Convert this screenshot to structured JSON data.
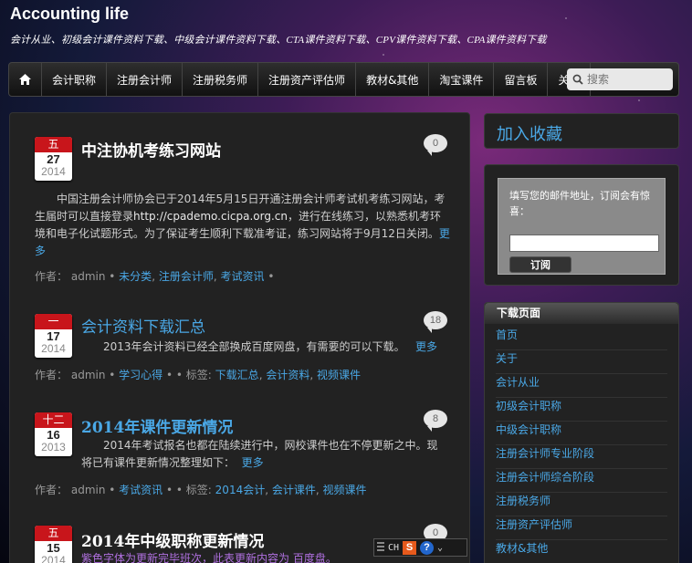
{
  "header": {
    "title": "Accounting life",
    "description": "会计从业、初级会计课件资料下载、中级会计课件资料下载、CTA课件资料下载、CPV课件资料下载、CPA课件资料下载"
  },
  "nav": {
    "items": [
      "会计职称",
      "注册会计师",
      "注册税务师",
      "注册资产评估师",
      "教材&其他",
      "淘宝课件",
      "留言板",
      "关于"
    ],
    "search_placeholder": "搜索"
  },
  "posts": [
    {
      "month": "五",
      "day": "27",
      "year": "2014",
      "title": "中注协机考练习网站",
      "comments": "0",
      "excerpt_text": "中国注册会计师协会已于2014年5月15日开通注册会计师考试机考练习网站，考生届时可以直接登录",
      "excerpt_link": "http://cpademo.cicpa.org.cn",
      "excerpt_after": "，进行在线练习，以熟悉机考环境和电子化试题形式。为了保证考生顺利下载准考证，练习网站将于9月12日关闭。",
      "more": "更多",
      "meta_author_label": "作者：",
      "meta_author": "admin",
      "meta_cats": [
        "未分类",
        "注册会计师",
        "考试资讯"
      ]
    },
    {
      "month": "一",
      "day": "17",
      "year": "2014",
      "title": "会计资料下载汇总",
      "comments": "18",
      "excerpt_text": "2013年会计资料已经全部换成百度网盘，有需要的可以下载。",
      "more": "更多",
      "meta_author_label": "作者：",
      "meta_author": "admin",
      "meta_cats": [
        "学习心得"
      ],
      "meta_tags_label": "标签:",
      "meta_tags": [
        "下载汇总",
        "会计资料",
        "视频课件"
      ]
    },
    {
      "month": "十二",
      "day": "16",
      "year": "2013",
      "title": "2014年课件更新情况",
      "comments": "8",
      "excerpt_text": "2014年考试报名也都在陆续进行中，网校课件也在不停更新之中。现将已有课件更新情况整理如下：",
      "more": "更多",
      "meta_author_label": "作者：",
      "meta_author": "admin",
      "meta_cats": [
        "考试资讯"
      ],
      "meta_tags_label": "标签:",
      "meta_tags": [
        "2014会计",
        "会计课件",
        "视频课件"
      ]
    },
    {
      "month": "五",
      "day": "15",
      "year": "2014",
      "title": "2014年中级职称更新情况",
      "comments": "0",
      "excerpt_text": "紫色字体为更新完毕班次，此表更新内容为 百度盘。"
    }
  ],
  "sidebar": {
    "favorite": "加入收藏",
    "subscribe_text": "填写您的邮件地址，订阅会有惊喜：",
    "subscribe_button": "订阅",
    "pages_title": "下载页面",
    "pages": [
      "首页",
      "关于",
      "会计从业",
      "初级会计职称",
      "中级会计职称",
      "注册会计师专业阶段",
      "注册会计师综合阶段",
      "注册税务师",
      "注册资产评估师",
      "教材&其他"
    ]
  },
  "ime": {
    "mode": "CH",
    "s": "S",
    "help": "?"
  }
}
